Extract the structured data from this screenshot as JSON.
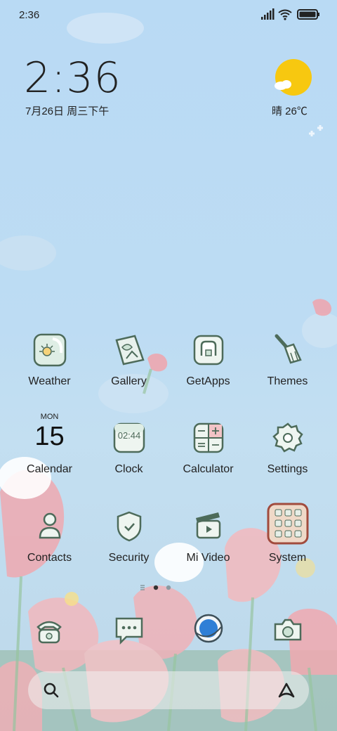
{
  "status_bar": {
    "time": "2:36"
  },
  "clock_widget": {
    "time": "2:36",
    "date": "7月26日 周三下午"
  },
  "weather_widget": {
    "text": "晴 26℃",
    "icon": "sun-cloud-icon"
  },
  "apps": [
    {
      "label": "Weather",
      "icon": "weather-icon"
    },
    {
      "label": "Gallery",
      "icon": "gallery-icon"
    },
    {
      "label": "GetApps",
      "icon": "getapps-icon"
    },
    {
      "label": "Themes",
      "icon": "themes-icon"
    },
    {
      "label": "Calendar",
      "icon": "calendar-icon",
      "day": "MON",
      "date": "15"
    },
    {
      "label": "Clock",
      "icon": "clock-icon",
      "clock_text": "02:44"
    },
    {
      "label": "Calculator",
      "icon": "calculator-icon"
    },
    {
      "label": "Settings",
      "icon": "settings-icon"
    },
    {
      "label": "Contacts",
      "icon": "contacts-icon"
    },
    {
      "label": "Security",
      "icon": "security-icon"
    },
    {
      "label": "Mi Video",
      "icon": "video-icon"
    },
    {
      "label": "System",
      "icon": "system-folder-icon"
    }
  ],
  "dock": [
    {
      "icon": "phone-icon"
    },
    {
      "icon": "messages-icon"
    },
    {
      "icon": "browser-icon"
    },
    {
      "icon": "camera-icon"
    }
  ],
  "search_bar": {
    "search_icon": "search-icon",
    "assistant_icon": "assistant-icon"
  },
  "page_indicator": {
    "pages": 2,
    "current": 1
  }
}
